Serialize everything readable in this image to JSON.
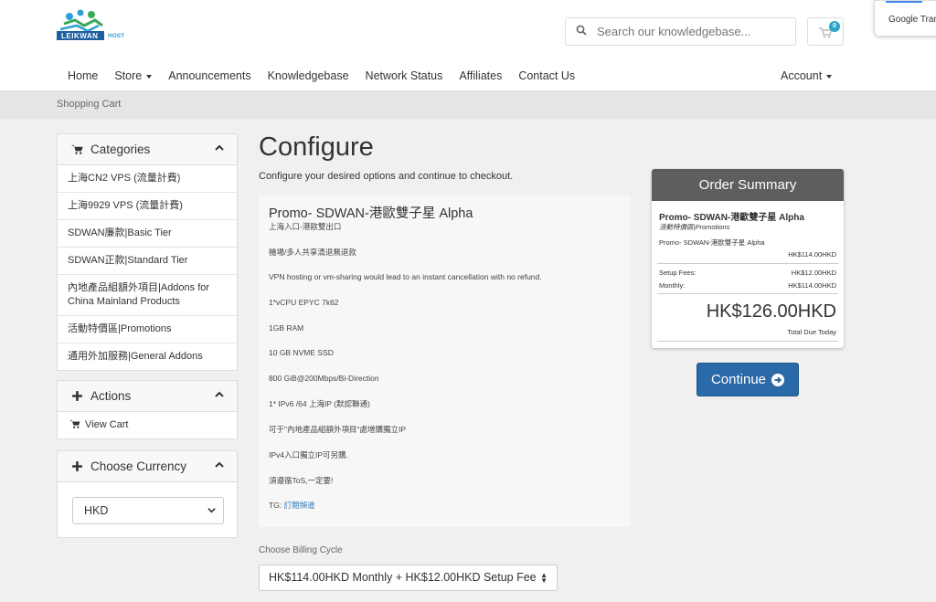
{
  "brand": {
    "logo_text": "LEIKWAN",
    "logo_sub": "HOST",
    "accent": "#2aa6c9",
    "primary": "#2b6aa8"
  },
  "search": {
    "placeholder": "Search our knowledgebase..."
  },
  "cart": {
    "count": "0"
  },
  "translate": {
    "label": "Google Translate"
  },
  "nav": {
    "items": [
      "Home",
      "Store",
      "Announcements",
      "Knowledgebase",
      "Network Status",
      "Affiliates",
      "Contact Us"
    ],
    "account": "Account"
  },
  "breadcrumb": "Shopping Cart",
  "sidebar": {
    "categories_title": "Categories",
    "categories": [
      "上海CN2 VPS (流量計費)",
      "上海9929 VPS (流量計費)",
      "SDWAN廉款|Basic Tier",
      "SDWAN正款|Standard Tier",
      "內地產品組額外項目|Addons for China Mainland Products",
      "活動特價區|Promotions",
      "通用外加服務|General Addons"
    ],
    "actions_title": "Actions",
    "view_cart": "View Cart",
    "currency_title": "Choose Currency",
    "currency_value": "HKD"
  },
  "main": {
    "title": "Configure",
    "subtitle": "Configure your desired options and continue to checkout.",
    "product": {
      "name": "Promo- SDWAN-港歐雙子星 Alpha",
      "lines": [
        "上海入口-港歐雙出口",
        "機場/多人共享清退無退款",
        "VPN hosting or vm-sharing would lead to an instant cancellation with no refund.",
        "1*vCPU EPYC 7k62",
        "1GB RAM",
        "10 GB NVME SSD",
        "800 GiB@200Mbps/Bi-Direction",
        "1* IPv6 /64 上海IP (默認聯通)",
        "可于\"內地產品組額外項目\"處增購獨立IP",
        "IPv4入口獨立IP可另購.",
        "須遵循ToS,一定要!"
      ],
      "tg_label": "TG: ",
      "tg_link": "訂閱頻道"
    },
    "billing_label": "Choose Billing Cycle",
    "billing_value": "HK$114.00HKD Monthly + HK$12.00HKD Setup Fee"
  },
  "summary": {
    "title": "Order Summary",
    "product": "Promo- SDWAN-港歐雙子星 Alpha",
    "group": "活動特價區|Promotions",
    "line_item": "Promo- SDWAN-港歐雙子星 Alpha",
    "line_price": "HK$114.00HKD",
    "setup_label": "Setup Fees:",
    "setup_value": "HK$12.00HKD",
    "monthly_label": "Monthly:",
    "monthly_value": "HK$114.00HKD",
    "total": "HK$126.00HKD",
    "total_label": "Total Due Today",
    "continue": "Continue"
  }
}
